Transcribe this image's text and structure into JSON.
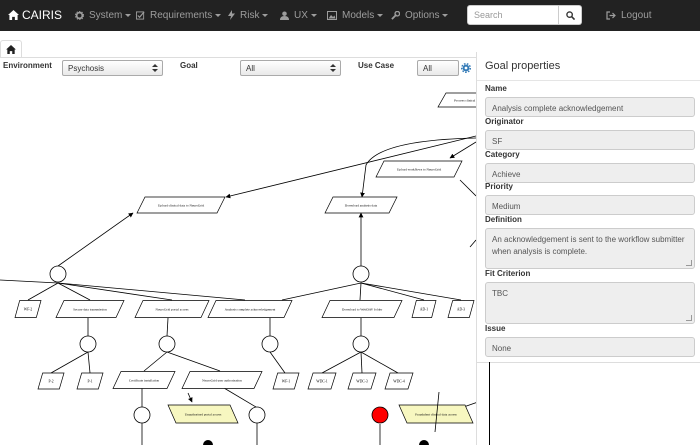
{
  "navbar": {
    "brand": "CAIRIS",
    "menus": [
      {
        "label": "System",
        "icon": "gear-icon"
      },
      {
        "label": "Requirements",
        "icon": "checkbox-icon"
      },
      {
        "label": "Risk",
        "icon": "lightning-icon"
      },
      {
        "label": "UX",
        "icon": "user-icon"
      },
      {
        "label": "Models",
        "icon": "picture-icon"
      },
      {
        "label": "Options",
        "icon": "wrench-icon"
      }
    ],
    "search_placeholder": "Search",
    "logout_label": "Logout"
  },
  "filters": {
    "environment_label": "Environment",
    "environment_value": "Psychosis",
    "goal_label": "Goal",
    "goal_value": "All",
    "usecase_label": "Use Case",
    "usecase_value": "All"
  },
  "graph": {
    "nodes": [
      "Process clinical data",
      "Upload workflows to NeuroGrid",
      "Upload clinical data to NeuroGrid",
      "Download analysis data",
      "WF-2",
      "Secure data transmission",
      "NeuroGrid portal access",
      "Analysis complete acknowledgement",
      "Download to WebDAV folder",
      "AD-1",
      "AD-3",
      "P-2",
      "P-1",
      "Certificate installation",
      "NeuroGrid user authorisation",
      "WF-1",
      "WDC-1",
      "WDC-3",
      "WDC-4",
      "Unauthorised portal access",
      "Fraudulent clinical data access",
      "Fraudulent clinical approval"
    ]
  },
  "properties": {
    "title": "Goal properties",
    "name_label": "Name",
    "name_value": "Analysis complete acknowledgement",
    "originator_label": "Originator",
    "originator_value": "SF",
    "category_label": "Category",
    "category_value": "Achieve",
    "priority_label": "Priority",
    "priority_value": "Medium",
    "definition_label": "Definition",
    "definition_value": "An acknowledgement is sent to the workflow submitter when analysis is complete.",
    "fit_label": "Fit Criterion",
    "fit_value": "TBC",
    "issue_label": "Issue",
    "issue_value": "None"
  },
  "colors": {
    "navbar": "#222222",
    "obstacle_fill": "#f7f7c0",
    "goal_selected": "#ff0000",
    "and_node": "#000000"
  }
}
